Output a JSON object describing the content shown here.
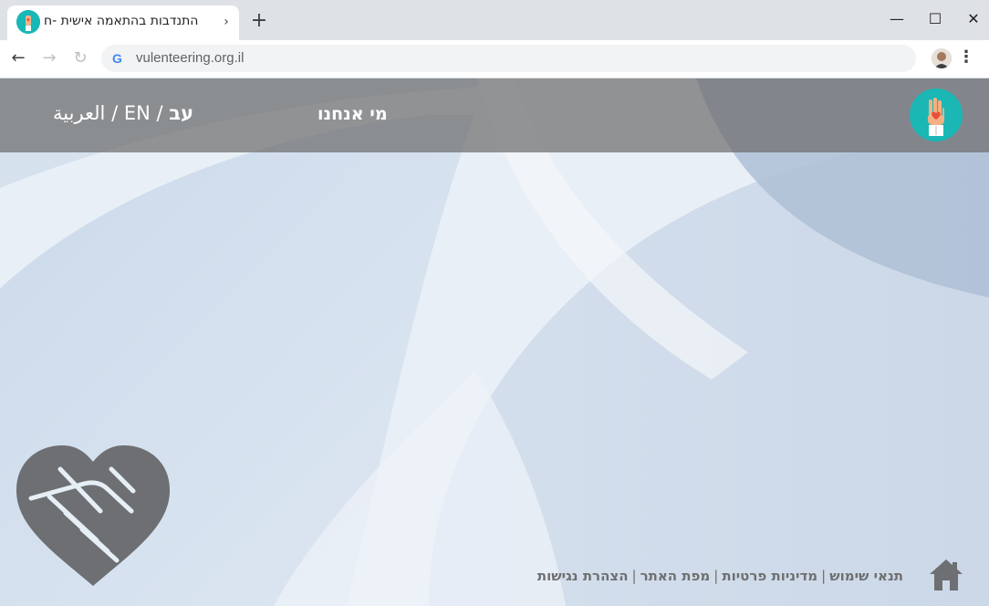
{
  "browser": {
    "tab_title": "התנדבות בהתאמה אישית -ח",
    "tab_close_glyph": "›",
    "new_tab_glyph": "+",
    "window_controls": {
      "minimize": "—",
      "maximize": "☐",
      "close": "✕"
    },
    "back_glyph": "←",
    "forward_glyph": "→",
    "reload_glyph": "↻",
    "url": "vulenteering.org.il",
    "search_engine_icon": "G",
    "menu_glyph": "⋮"
  },
  "header": {
    "lang_he": "עב",
    "lang_en": "EN",
    "lang_ar": "العربية",
    "lang_separator": " / ",
    "about_label": "מי אנחנו"
  },
  "footer": {
    "links": [
      "תנאי שימוש",
      "מדיניות פרטיות",
      "מפת האתר",
      "הצהרת נגישות"
    ],
    "separator": "|"
  },
  "colors": {
    "header_overlay": "#6e6e6e",
    "logo_teal": "#1bb7b5",
    "background": "#e6eef6",
    "accent_blue": "#a9bdd6",
    "icon_gray": "#6d6f73"
  },
  "icons": {
    "site_logo": "raised-hand-heart-icon",
    "handshake": "handshake-heart-icon",
    "home": "home-icon"
  }
}
